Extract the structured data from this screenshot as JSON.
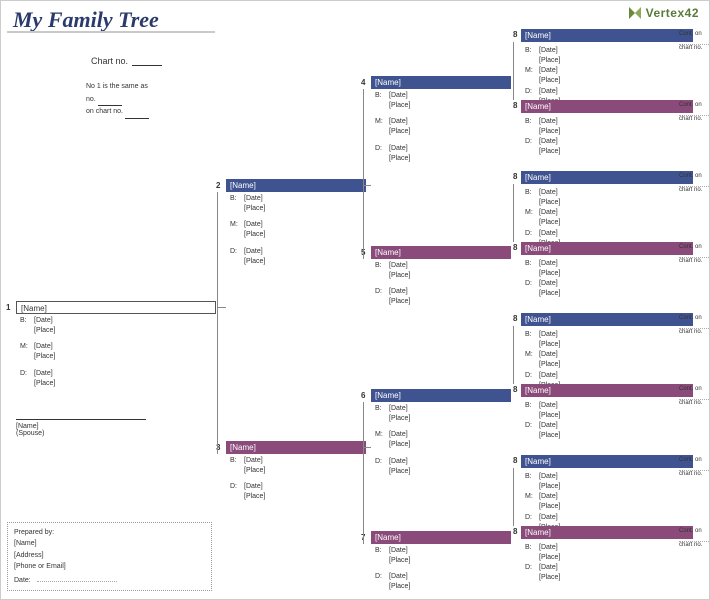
{
  "title": "My Family Tree",
  "logo": "Vertex42",
  "chart_no_label": "Chart no.",
  "note_line1": "No 1 is the same as",
  "note_line2_a": "no.",
  "note_line2_b": "on chart no.",
  "labels": {
    "name": "[Name]",
    "b": "B:",
    "m": "M:",
    "d": "D:",
    "date": "[Date]",
    "place": "[Place]",
    "spouse": "(Spouse)",
    "cont": "Cont. on",
    "chartno": "chart no."
  },
  "prepared": {
    "heading": "Prepared by:",
    "name": "[Name]",
    "address": "[Address]",
    "contact": "[Phone or Email]",
    "date": "Date:"
  },
  "persons": {
    "p1": {
      "num": "1"
    },
    "p2": {
      "num": "2"
    },
    "p3": {
      "num": "3"
    },
    "p4": {
      "num": "4"
    },
    "p5": {
      "num": "5"
    },
    "p6": {
      "num": "6"
    },
    "p7": {
      "num": "7"
    }
  },
  "ancestors_num": "8"
}
